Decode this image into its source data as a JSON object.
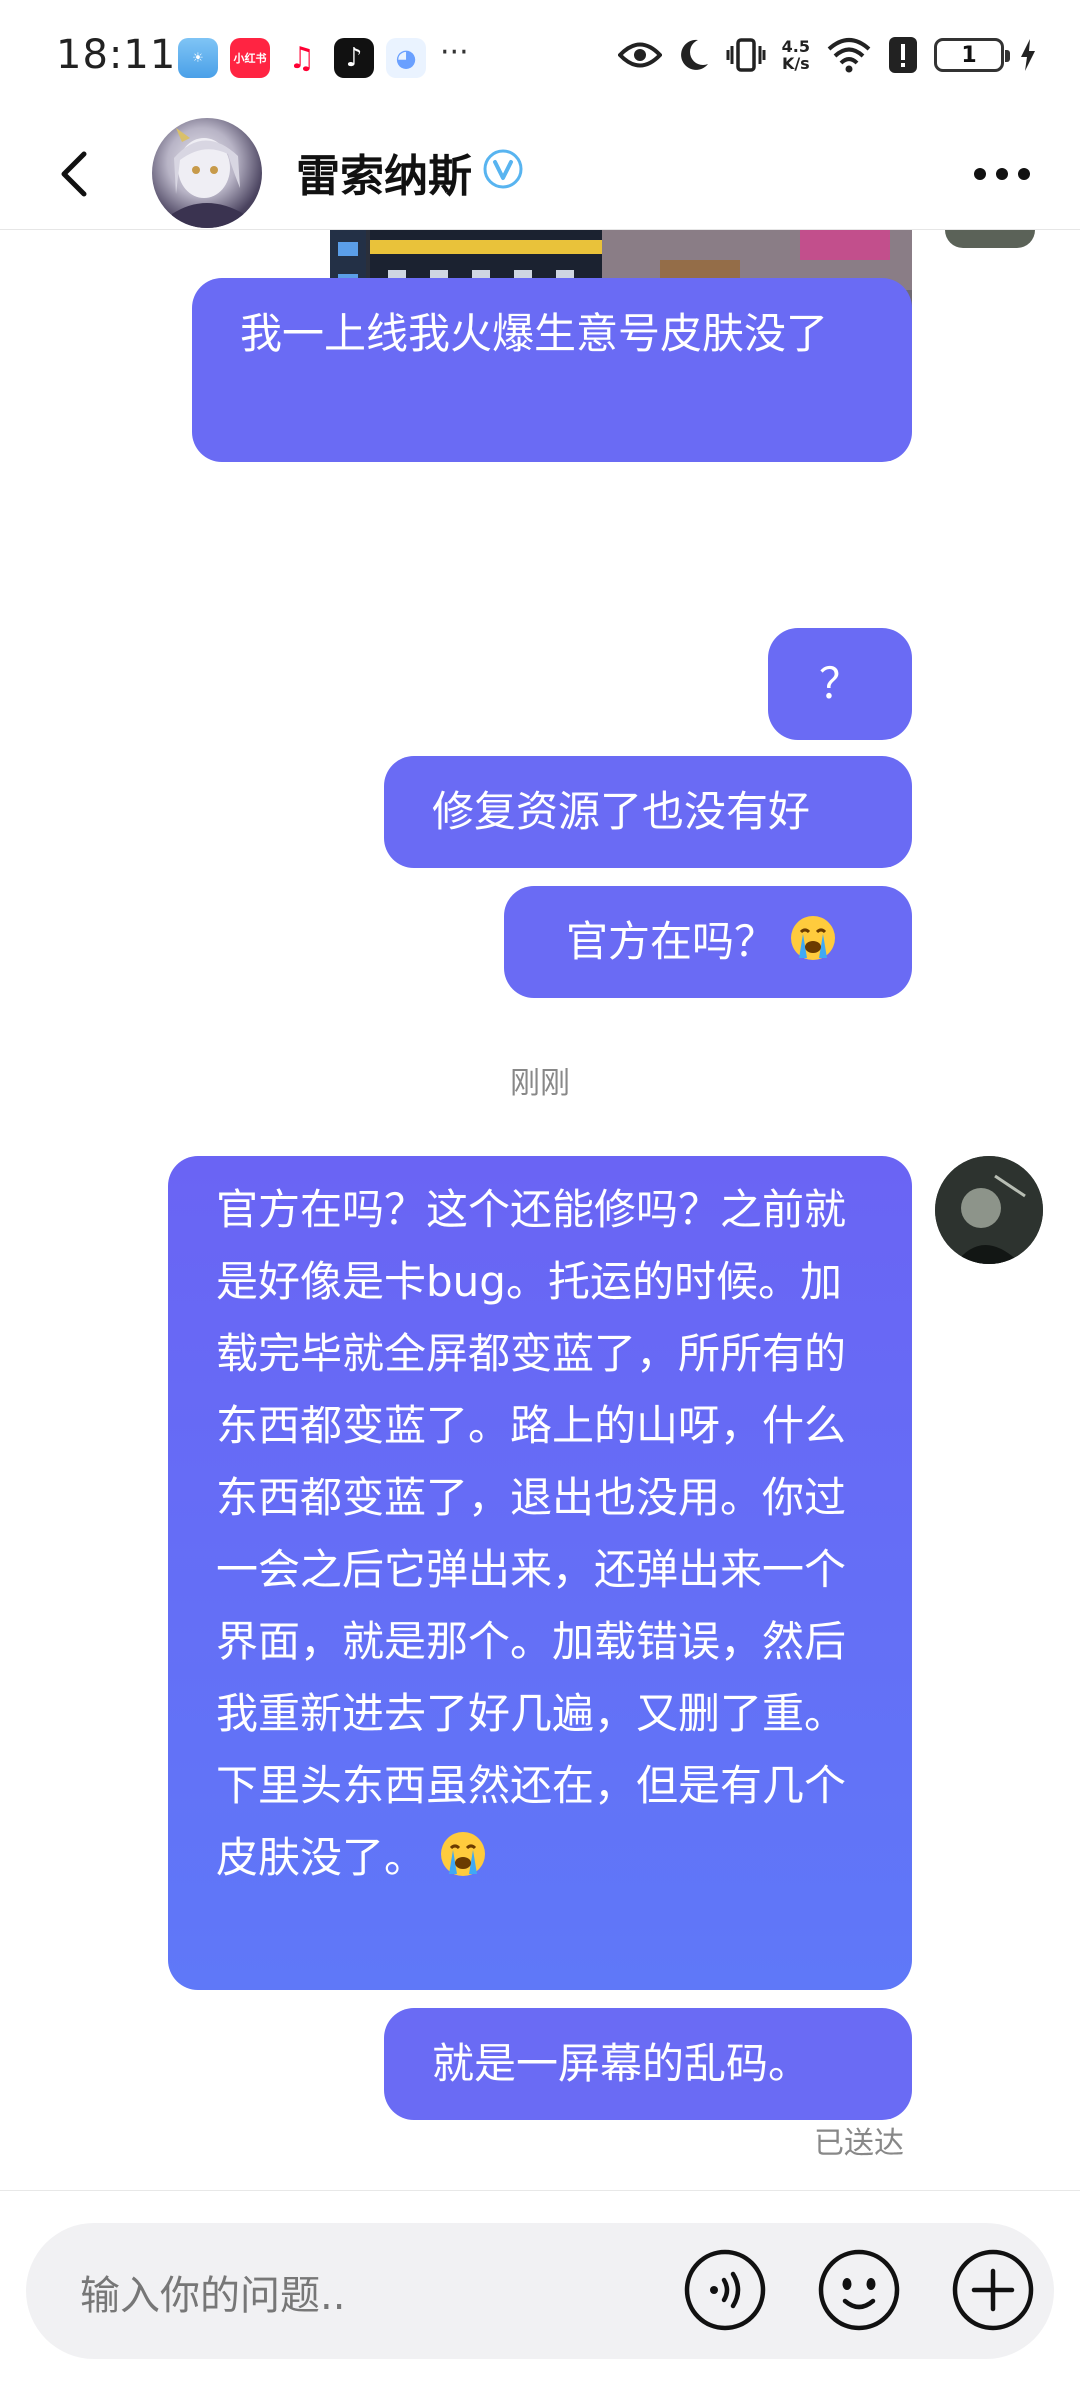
{
  "status_bar": {
    "time": "18:11",
    "app_icons": [
      "weather-icon",
      "xiaohongshu-icon",
      "music-icon",
      "tiktok-icon",
      "assistant-icon"
    ],
    "xiaohongshu_label": "小红书",
    "more": "···",
    "net_speed_top": "4.5",
    "net_speed_bottom": "K/s",
    "battery_level": "1"
  },
  "header": {
    "contact_name": "雷索纳斯",
    "verified": true
  },
  "messages": [
    {
      "type": "image",
      "side": "right",
      "content": "game-screenshot"
    },
    {
      "type": "text",
      "side": "right",
      "text": "我一上线我火爆生意号皮肤没了"
    },
    {
      "type": "text",
      "side": "right",
      "text": "？"
    },
    {
      "type": "text",
      "side": "right",
      "text": "修复资源了也没有好"
    },
    {
      "type": "text",
      "side": "right",
      "text": "官方在吗？",
      "emoji": "crying-emoji"
    },
    {
      "type": "timestamp",
      "text": "刚刚"
    },
    {
      "type": "text",
      "side": "right",
      "text": "官方在吗？这个还能修吗？之前就是好像是卡bug。托运的时候。加载完毕就全屏都变蓝了，所所有的东西都变蓝了。路上的山呀，什么东西都变蓝了，退出也没用。你过一会之后它弹出来，还弹出来一个界面，就是那个。加载错误，然后我重新进去了好几遍，又删了重。下里头东西虽然还在，但是有几个皮肤没了。",
      "emoji": "crying-emoji"
    },
    {
      "type": "text",
      "side": "right",
      "text": "就是一屏幕的乱码。"
    }
  ],
  "status_delivered": "已送达",
  "input": {
    "placeholder": "输入你的问题.."
  },
  "colors": {
    "bubble": "#6a6bf4",
    "bubble_gradient_end": "#5f78f8",
    "header_border": "#e6e6e6",
    "input_bg": "#f1f1f3",
    "verified": "#58b4f0"
  }
}
